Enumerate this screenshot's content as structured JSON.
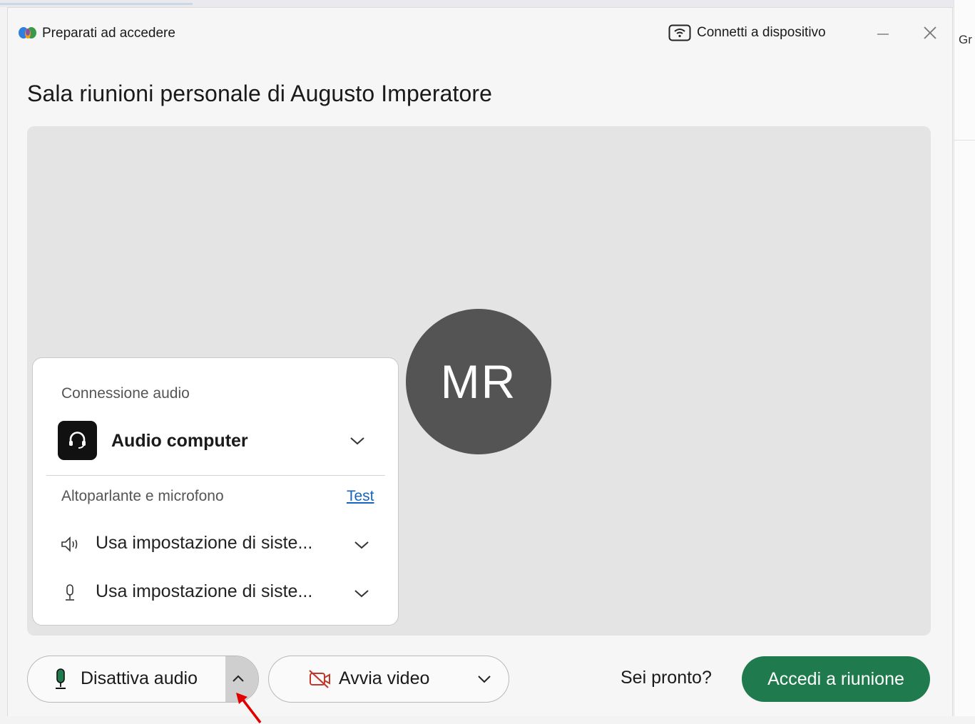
{
  "window": {
    "title": "Preparati ad accedere",
    "connect_label": "Connetti a dispositivo"
  },
  "background": {
    "right_edge_text": "Gr"
  },
  "meeting": {
    "room_title": "Sala riunioni personale di Augusto Imperatore"
  },
  "preview": {
    "avatar_initials": "MR"
  },
  "audio_panel": {
    "connection_label": "Connessione audio",
    "connection_value": "Audio computer",
    "devices_label": "Altoparlante e microfono",
    "test_link": "Test",
    "speaker_value": "Usa impostazione di siste...",
    "mic_value": "Usa impostazione di siste..."
  },
  "controls": {
    "mute_label": "Disattiva audio",
    "video_label": "Avvia video",
    "ready_text": "Sei pronto?",
    "join_label": "Accedi a riunione"
  },
  "colors": {
    "join_button": "#1f7a4d",
    "avatar_bg": "#545454",
    "link": "#1565c0",
    "video_off_icon": "#c0392b",
    "annotation_arrow": "#e00000"
  },
  "icons": [
    "webex-logo-icon",
    "cast-device-icon",
    "minimize-icon",
    "close-icon",
    "headset-icon",
    "chevron-down-icon",
    "speaker-icon",
    "microphone-icon",
    "chevron-up-icon",
    "video-off-icon",
    "red-arrow-annotation"
  ]
}
